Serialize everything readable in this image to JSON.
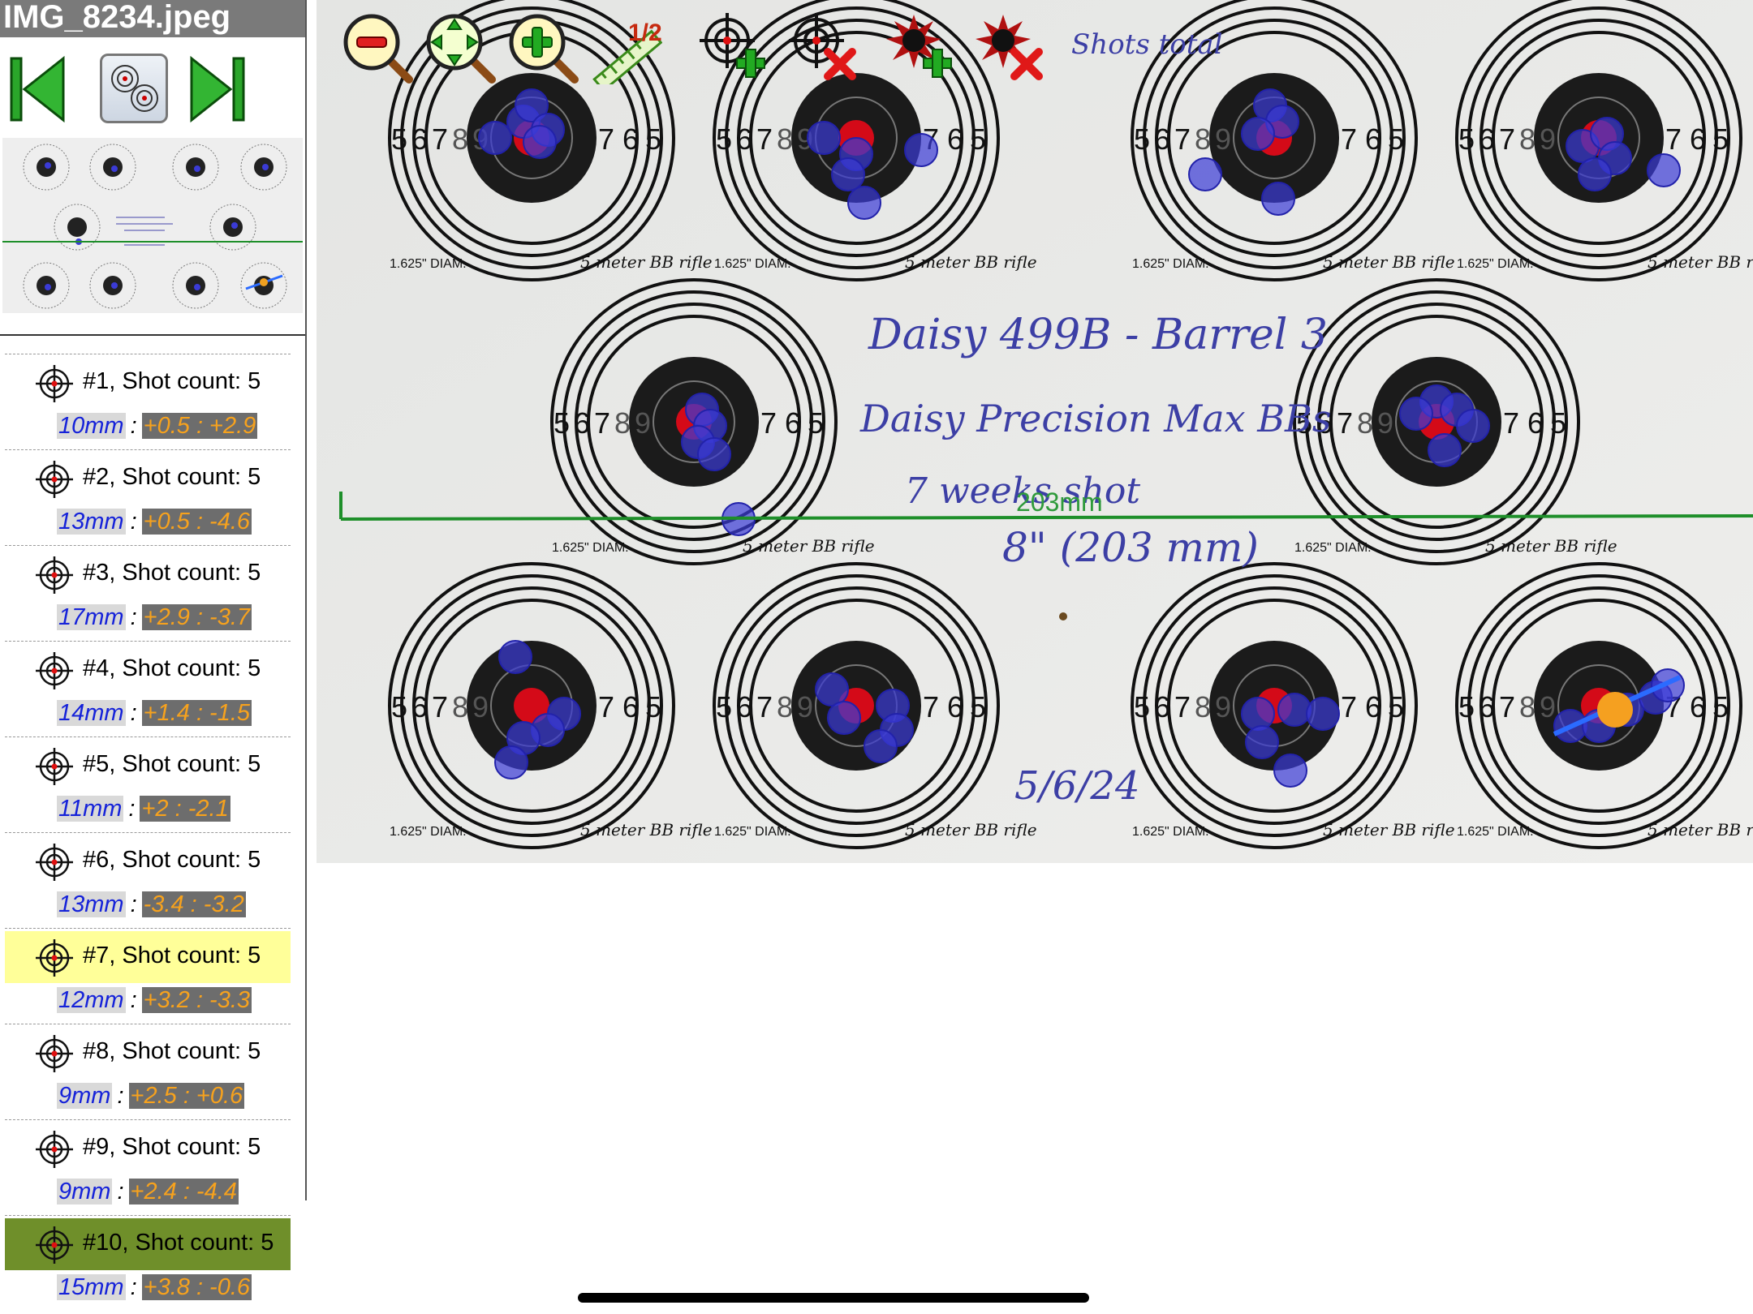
{
  "file_name": "IMG_8234.jpeg",
  "toolbar": {
    "icons": [
      "zoom-out-icon",
      "zoom-fit-icon",
      "zoom-in-icon",
      "scale-ruler-icon",
      "add-target-icon",
      "remove-target-icon",
      "add-shot-icon",
      "remove-shot-icon"
    ],
    "ruler_label": "1/2"
  },
  "targets": [
    {
      "title": "#1, Shot count: 5",
      "group": "10mm",
      "offset": "+0.5 : +2.9"
    },
    {
      "title": "#2, Shot count: 5",
      "group": "13mm",
      "offset": "+0.5 : -4.6"
    },
    {
      "title": "#3, Shot count: 5",
      "group": "17mm",
      "offset": "+2.9 : -3.7"
    },
    {
      "title": "#4, Shot count: 5",
      "group": "14mm",
      "offset": "+1.4 : -1.5"
    },
    {
      "title": "#5, Shot count: 5",
      "group": "11mm",
      "offset": "+2 : -2.1"
    },
    {
      "title": "#6, Shot count: 5",
      "group": "13mm",
      "offset": "-3.4 : -3.2"
    },
    {
      "title": "#7, Shot count: 5",
      "group": "12mm",
      "offset": "+3.2 : -3.3"
    },
    {
      "title": "#8, Shot count: 5",
      "group": "9mm",
      "offset": "+2.5 : +0.6"
    },
    {
      "title": "#9, Shot count: 5",
      "group": "9mm",
      "offset": "+2.4 : -4.4"
    },
    {
      "title": "#10, Shot count: 5",
      "group": "15mm",
      "offset": "+3.8 : -0.6"
    }
  ],
  "highlighted_target": "#7",
  "selected_target": "#10",
  "photo": {
    "ring_numbers": [
      "5",
      "6",
      "7",
      "8",
      "9"
    ],
    "handwriting": {
      "line1": "Daisy 499B - Barrel 3",
      "line2": "Daisy Precision Max BBs",
      "line3": "7 weeks shot",
      "line4": "8\" (203 mm)",
      "date": "5/6/24",
      "note": "Shots total"
    },
    "target_caption": "5 meter BB rifle",
    "diam_caption": "1.625\" DIAM.",
    "scale_label": "203mm"
  },
  "colors": {
    "highlight": "#ffff99",
    "selected": "#6f8f2a",
    "group_text": "#1522d9",
    "offset_text": "#f7a21d",
    "offset_bg": "#6d6d6d",
    "scale_line": "#1e8f2a",
    "shot_fill": "#3b3bd6"
  }
}
